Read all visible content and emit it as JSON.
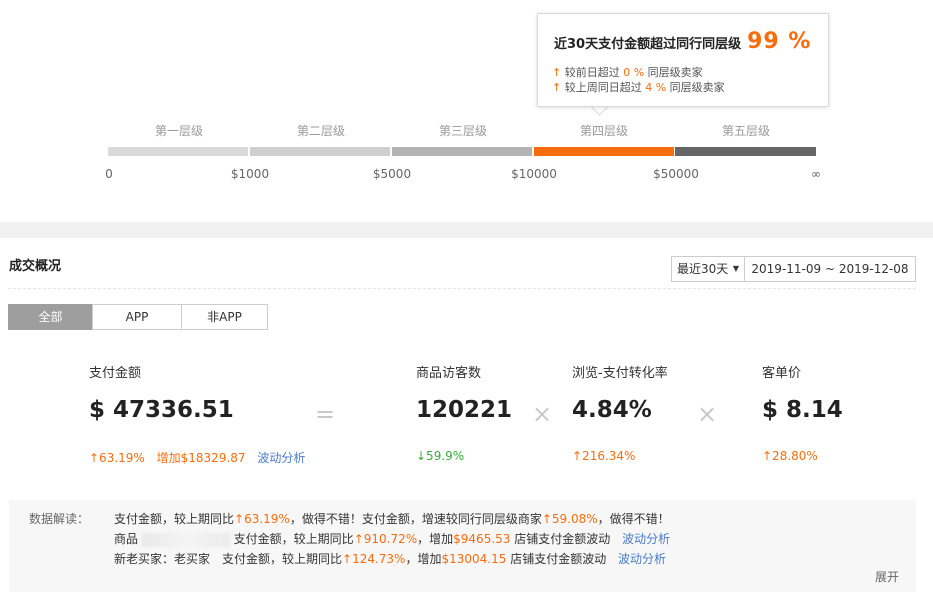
{
  "tooltip": {
    "headline": "近30天支付金额超过同行同层级",
    "percent": "99 %",
    "line1": {
      "arrow": "↑",
      "prefix": "较前日超过 ",
      "value": "0 %",
      "suffix": " 同层级卖家"
    },
    "line2": {
      "arrow": "↑",
      "prefix": "较上周同日超过 ",
      "value": "4 %",
      "suffix": " 同层级卖家"
    }
  },
  "tiers": {
    "labels": [
      "第一层级",
      "第二层级",
      "第三层级",
      "第四层级",
      "第五层级"
    ],
    "ticks": [
      "0",
      "$1000",
      "$5000",
      "$10000",
      "$50000",
      "∞"
    ],
    "current_index": 3,
    "colors": [
      "#d9d9d9",
      "#cfcfcf",
      "#b3b3b3",
      "#f76c0c",
      "#666666"
    ]
  },
  "overview": {
    "title": "成交概况",
    "period": "最近30天",
    "date_range": "2019-11-09 ~ 2019-12-08",
    "segments": [
      "全部",
      "APP",
      "非APP"
    ],
    "active_segment": 0
  },
  "metrics": {
    "payment": {
      "label": "支付金额",
      "value": "$ 47336.51",
      "change": "↑63.19%",
      "increase": "增加$18329.87",
      "link": "波动分析"
    },
    "visitors": {
      "label": "商品访客数",
      "value": "120221",
      "change": "↓59.9%"
    },
    "conversion": {
      "label": "浏览-支付转化率",
      "value": "4.84%",
      "change": "↑216.34%"
    },
    "unit_price": {
      "label": "客单价",
      "value": "$ 8.14",
      "change": "↑28.80%"
    },
    "ops": {
      "equals": "=",
      "times": "×"
    }
  },
  "interpretation": {
    "label": "数据解读：",
    "line1": {
      "t1": "支付金额，较上期同比",
      "v1": "↑63.19%",
      "t2": "，做得不错！支付金额，增速较同行同层级商家",
      "v2": "↑59.08%",
      "t3": "，做得不错！"
    },
    "line2": {
      "t1": "商品",
      "t2": "支付金额，较上期同比",
      "v1": "↑910.72%",
      "t3": "，增加",
      "v2": "$9465.53",
      "t4": " 店铺支付金额波动",
      "link": "波动分析"
    },
    "line3": {
      "t1": "新老买家：老买家　支付金额，较上期同比",
      "v1": "↑124.73%",
      "t2": "，增加",
      "v2": "$13004.15",
      "t3": " 店铺支付金额波动",
      "link": "波动分析"
    },
    "expand": "展开"
  }
}
